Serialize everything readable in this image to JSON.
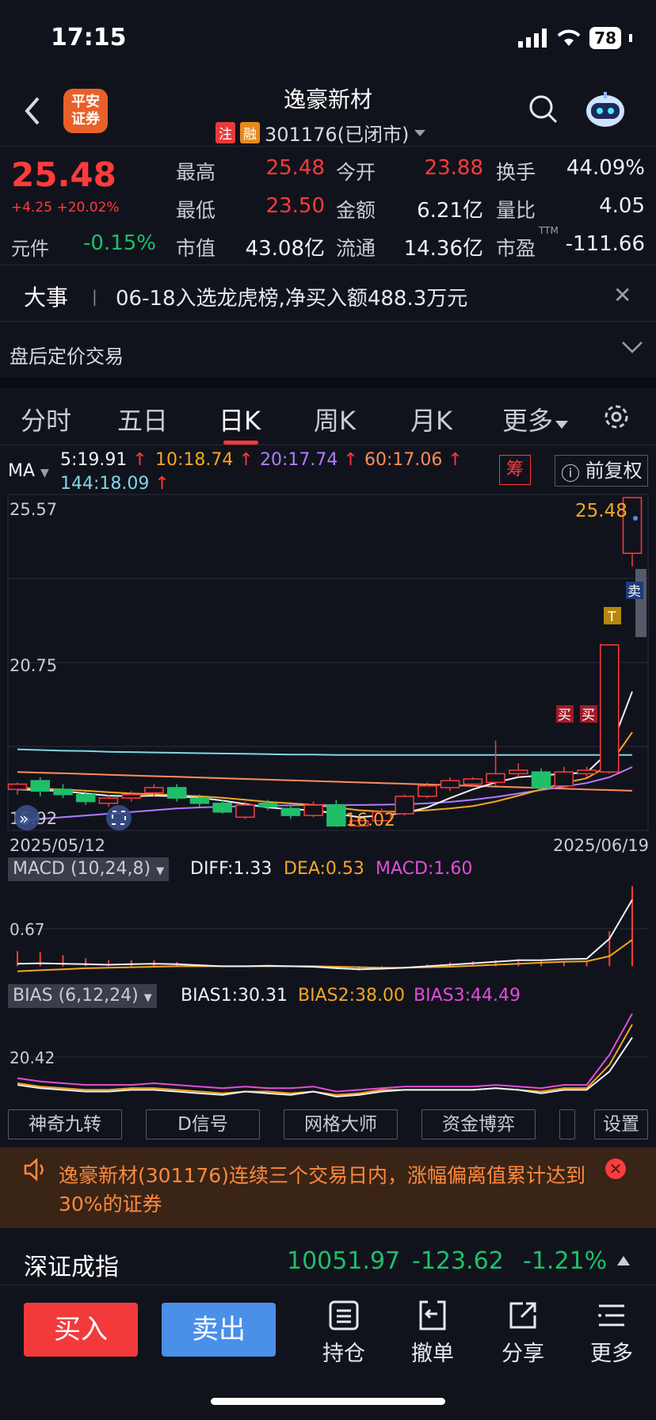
{
  "status": {
    "time": "17:15",
    "battery": "78"
  },
  "header": {
    "broker_logo": "平安\n证券",
    "stock_name": "逸豪新材",
    "tag_zhu": "注",
    "tag_rong": "融",
    "code_status": "301176(已闭市)"
  },
  "quote": {
    "last_price": "25.48",
    "change": "+4.25 +20.02%",
    "yuanjian_label": "元件",
    "yuanjian_value": "-0.15%",
    "high_label": "最高",
    "high": "25.48",
    "open_label": "今开",
    "open": "23.88",
    "turnover_label": "换手",
    "turnover": "44.09%",
    "low_label": "最低",
    "low": "23.50",
    "amount_label": "金额",
    "amount": "6.21亿",
    "volratio_label": "量比",
    "volratio": "4.05",
    "mcap_label": "市值",
    "mcap": "43.08亿",
    "float_label": "流通",
    "float": "14.36亿",
    "pe_label": "市盈",
    "pe_sup": "TTM",
    "pe": "-111.66"
  },
  "event": {
    "tag": "大事",
    "text": "06-18入选龙虎榜,净买入额488.3万元"
  },
  "afterhours": {
    "label": "盘后定价交易"
  },
  "tabs": [
    "分时",
    "五日",
    "日K",
    "周K",
    "月K",
    "更多"
  ],
  "ma_legend": {
    "label": "MA",
    "ma5": "5:19.91",
    "ma10": "10:18.74",
    "ma20": "20:17.74",
    "ma60": "60:17.06",
    "ma144": "144:18.09",
    "chou": "筹",
    "adjust": "前复权"
  },
  "kline": {
    "y_top": "25.57",
    "y_mid": "20.75",
    "y_bottom": "15.92",
    "low_mark": "16.02",
    "last_mark": "25.48",
    "date_start": "2025/05/12",
    "date_end": "2025/06/19",
    "buy_mark": "买",
    "sell_mark": "卖",
    "t_mark": "T"
  },
  "macd": {
    "header": "MACD (10,24,8)",
    "diff": "DIFF:1.33",
    "dea": "DEA:0.53",
    "macd": "MACD:1.60",
    "y_label": "0.67"
  },
  "bias": {
    "header": "BIAS (6,12,24)",
    "bias1": "BIAS1:30.31",
    "bias2": "BIAS2:38.00",
    "bias3": "BIAS3:44.49",
    "y_label": "20.42"
  },
  "tools": [
    "神奇九转",
    "D信号",
    "网格大师",
    "资金博弈",
    "设置"
  ],
  "alert": {
    "text": "逸豪新材(301176)连续三个交易日内，涨幅偏离值累计达到30%的证券"
  },
  "index": {
    "name": "深证成指",
    "value": "10051.97",
    "change": "-123.62",
    "pct": "-1.21%"
  },
  "bottom": {
    "buy": "买入",
    "sell": "卖出",
    "hold": "持仓",
    "cancel": "撤单",
    "share": "分享",
    "more": "更多"
  },
  "chart_data": {
    "type": "candlestick",
    "x_range": [
      "2025/05/12",
      "2025/06/19"
    ],
    "y_ticks": [
      25.57,
      20.75,
      15.92
    ],
    "ylim": [
      15.92,
      25.57
    ],
    "candles": [
      {
        "o": 17.1,
        "c": 17.25,
        "h": 17.3,
        "l": 16.95
      },
      {
        "o": 17.35,
        "c": 17.05,
        "h": 17.45,
        "l": 16.9
      },
      {
        "o": 17.1,
        "c": 16.95,
        "h": 17.25,
        "l": 16.85
      },
      {
        "o": 16.95,
        "c": 16.75,
        "h": 17.05,
        "l": 16.65
      },
      {
        "o": 16.7,
        "c": 16.85,
        "h": 16.95,
        "l": 16.6
      },
      {
        "o": 16.85,
        "c": 16.95,
        "h": 17.05,
        "l": 16.75
      },
      {
        "o": 17.0,
        "c": 17.15,
        "h": 17.25,
        "l": 16.9
      },
      {
        "o": 17.15,
        "c": 16.85,
        "h": 17.25,
        "l": 16.75
      },
      {
        "o": 16.85,
        "c": 16.7,
        "h": 16.95,
        "l": 16.6
      },
      {
        "o": 16.7,
        "c": 16.45,
        "h": 16.8,
        "l": 16.4
      },
      {
        "o": 16.3,
        "c": 16.65,
        "h": 16.75,
        "l": 16.25
      },
      {
        "o": 16.7,
        "c": 16.6,
        "h": 16.8,
        "l": 16.5
      },
      {
        "o": 16.55,
        "c": 16.35,
        "h": 16.65,
        "l": 16.25
      },
      {
        "o": 16.35,
        "c": 16.65,
        "h": 16.75,
        "l": 16.3
      },
      {
        "o": 16.65,
        "c": 16.05,
        "h": 16.8,
        "l": 16.02
      },
      {
        "o": 16.05,
        "c": 16.2,
        "h": 16.3,
        "l": 16.02
      },
      {
        "o": 16.2,
        "c": 16.45,
        "h": 16.55,
        "l": 16.15
      },
      {
        "o": 16.4,
        "c": 16.9,
        "h": 16.95,
        "l": 16.35
      },
      {
        "o": 16.9,
        "c": 17.2,
        "h": 17.3,
        "l": 16.85
      },
      {
        "o": 17.15,
        "c": 17.35,
        "h": 17.45,
        "l": 17.05
      },
      {
        "o": 17.25,
        "c": 17.4,
        "h": 17.45,
        "l": 17.2
      },
      {
        "o": 17.3,
        "c": 17.55,
        "h": 18.5,
        "l": 17.2
      },
      {
        "o": 17.55,
        "c": 17.65,
        "h": 17.85,
        "l": 17.45
      },
      {
        "o": 17.6,
        "c": 17.15,
        "h": 17.7,
        "l": 17.05
      },
      {
        "o": 17.2,
        "c": 17.6,
        "h": 17.75,
        "l": 17.15
      },
      {
        "o": 17.55,
        "c": 17.65,
        "h": 17.75,
        "l": 17.45
      },
      {
        "o": 17.6,
        "c": 21.25,
        "h": 21.25,
        "l": 17.55
      },
      {
        "o": 23.88,
        "c": 25.48,
        "h": 25.48,
        "l": 23.5
      }
    ],
    "ma5": [
      17.1,
      17.08,
      17.05,
      16.98,
      16.92,
      16.9,
      16.92,
      16.9,
      16.86,
      16.78,
      16.68,
      16.58,
      16.53,
      16.5,
      16.4,
      16.3,
      16.35,
      16.42,
      16.58,
      16.85,
      17.1,
      17.3,
      17.45,
      17.5,
      17.55,
      17.58,
      18.2,
      19.91
    ],
    "ma10": [
      17.15,
      17.12,
      17.1,
      17.06,
      17.02,
      16.98,
      16.96,
      16.93,
      16.9,
      16.86,
      16.8,
      16.74,
      16.7,
      16.65,
      16.58,
      16.5,
      16.46,
      16.46,
      16.5,
      16.55,
      16.62,
      16.75,
      16.92,
      17.1,
      17.28,
      17.42,
      17.8,
      18.74
    ],
    "ma20": [
      16.2,
      16.25,
      16.3,
      16.35,
      16.4,
      16.45,
      16.5,
      16.55,
      16.58,
      16.6,
      16.62,
      16.63,
      16.64,
      16.65,
      16.65,
      16.65,
      16.66,
      16.67,
      16.7,
      16.74,
      16.8,
      16.88,
      16.98,
      17.08,
      17.18,
      17.28,
      17.45,
      17.74
    ],
    "ma60": [
      17.6,
      17.58,
      17.56,
      17.54,
      17.52,
      17.5,
      17.48,
      17.46,
      17.44,
      17.42,
      17.4,
      17.38,
      17.36,
      17.34,
      17.32,
      17.3,
      17.28,
      17.26,
      17.24,
      17.22,
      17.2,
      17.18,
      17.16,
      17.14,
      17.12,
      17.1,
      17.08,
      17.06
    ],
    "ma144": [
      18.25,
      18.23,
      18.21,
      18.2,
      18.18,
      18.17,
      18.16,
      18.15,
      18.14,
      18.13,
      18.12,
      18.11,
      18.1,
      18.1,
      18.09,
      18.09,
      18.09,
      18.09,
      18.09,
      18.09,
      18.09,
      18.09,
      18.09,
      18.09,
      18.09,
      18.09,
      18.09,
      18.09
    ],
    "macd_series": {
      "diff": [
        0.05,
        0.06,
        0.05,
        0.04,
        0.03,
        0.04,
        0.05,
        0.04,
        0.02,
        0.0,
        0.0,
        0.01,
        0.0,
        -0.01,
        -0.04,
        -0.06,
        -0.05,
        -0.03,
        0.0,
        0.03,
        0.06,
        0.09,
        0.12,
        0.12,
        0.14,
        0.15,
        0.55,
        1.33
      ],
      "dea": [
        -0.1,
        -0.08,
        -0.06,
        -0.04,
        -0.03,
        -0.02,
        -0.01,
        0.0,
        0.0,
        0.0,
        0.0,
        0.0,
        0.0,
        0.0,
        -0.01,
        -0.02,
        -0.03,
        -0.03,
        -0.02,
        -0.01,
        0.01,
        0.03,
        0.05,
        0.07,
        0.09,
        0.1,
        0.2,
        0.53
      ],
      "macd": [
        0.3,
        0.28,
        0.22,
        0.16,
        0.12,
        0.12,
        0.12,
        0.08,
        0.04,
        0.0,
        0.0,
        0.02,
        0.0,
        -0.02,
        -0.06,
        -0.08,
        -0.04,
        0.0,
        0.04,
        0.08,
        0.1,
        0.12,
        0.14,
        0.1,
        0.1,
        0.1,
        0.7,
        1.6
      ]
    },
    "bias_series": {
      "bias1": [
        2,
        0,
        -1,
        -2,
        -2,
        -1,
        -1,
        -2,
        -3,
        -4,
        -2,
        -3,
        -4,
        -2,
        -5,
        -4,
        -2,
        -1,
        -1,
        -1,
        -1,
        0,
        -1,
        -3,
        -1,
        -1,
        10,
        30.31
      ],
      "bias2": [
        3,
        1,
        0,
        -1,
        -1,
        0,
        0,
        -1,
        -2,
        -3,
        -2,
        -2,
        -3,
        -2,
        -4,
        -3,
        -1,
        -1,
        -1,
        -1,
        -1,
        0,
        -1,
        -2,
        0,
        0,
        14,
        38.0
      ],
      "bias3": [
        6,
        4,
        3,
        2,
        2,
        2,
        3,
        2,
        1,
        0,
        1,
        0,
        0,
        1,
        -2,
        -1,
        0,
        1,
        1,
        1,
        1,
        2,
        1,
        0,
        2,
        2,
        20,
        44.49
      ]
    }
  }
}
